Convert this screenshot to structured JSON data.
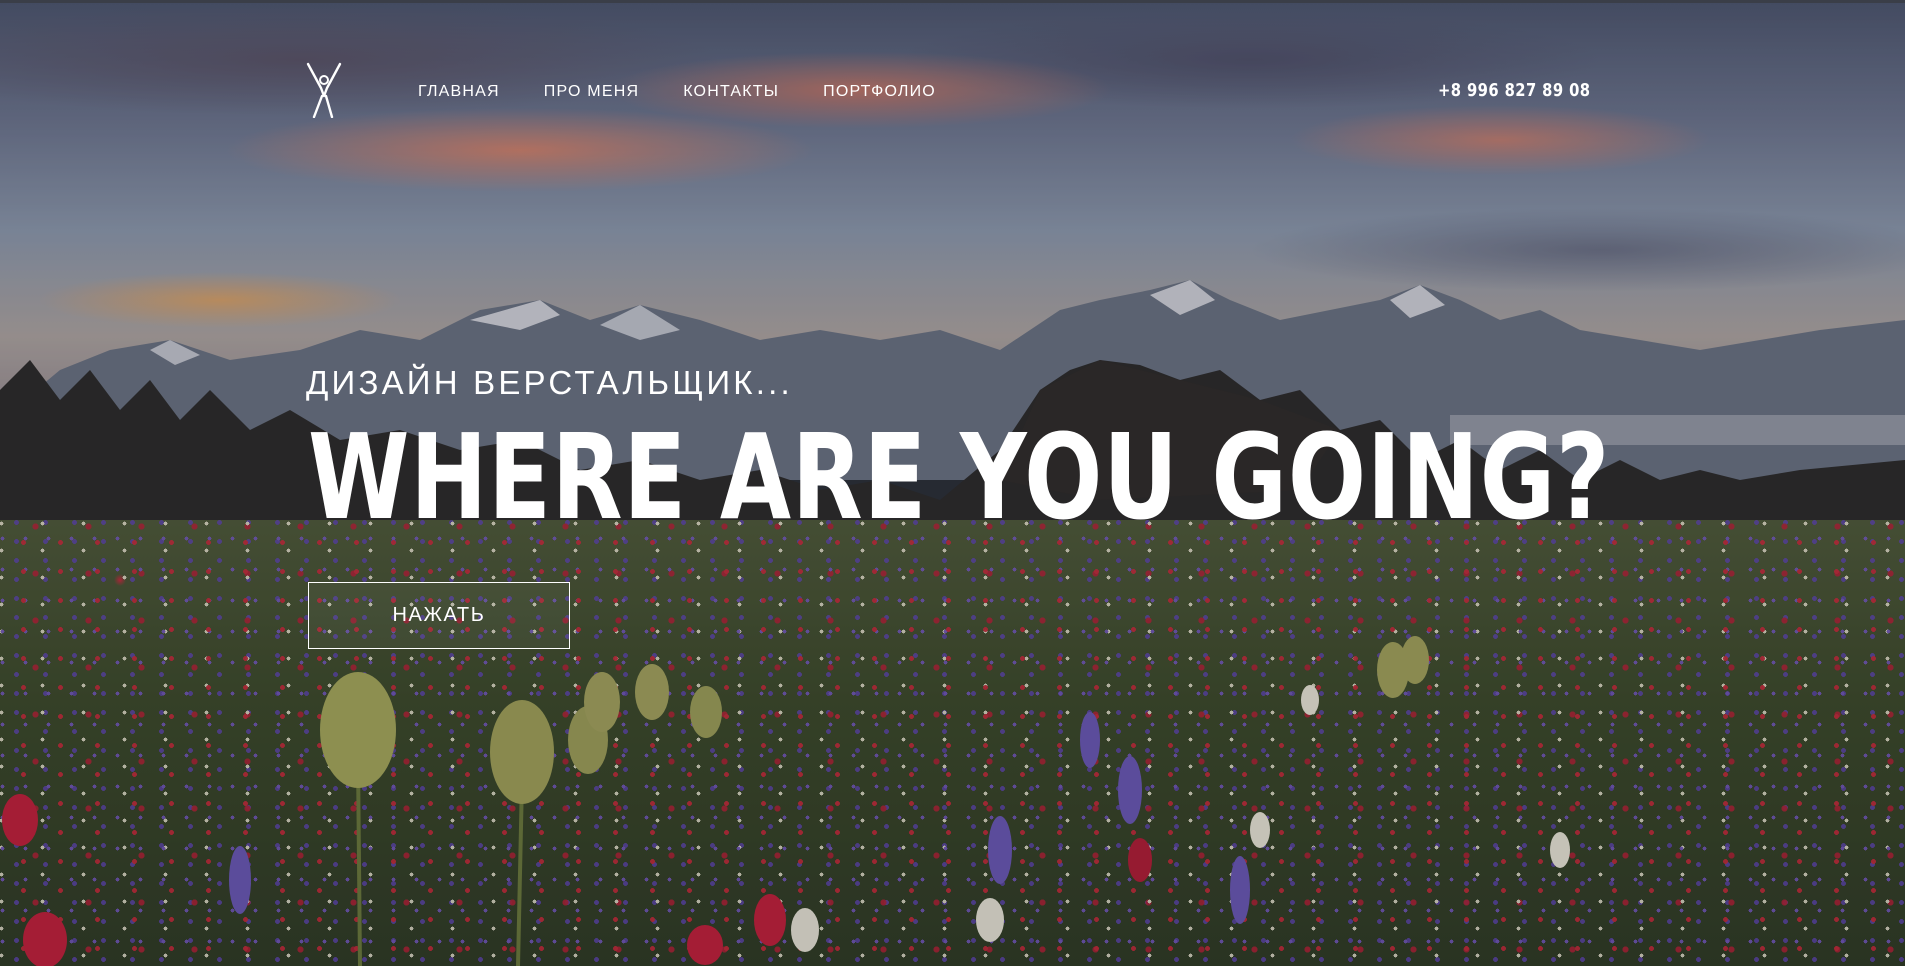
{
  "header": {
    "logo_icon": "person-arms-up-icon",
    "nav": [
      {
        "label": "ГЛАВНАЯ"
      },
      {
        "label": "ПРО МЕНЯ"
      },
      {
        "label": "КОНТАКТЫ"
      },
      {
        "label": "ПОРТФОЛИО"
      }
    ],
    "phone": "+8 996 827 89 08"
  },
  "hero": {
    "subtitle": "ДИЗАЙН ВЕРСТАЛЬЩИК...",
    "headline": "WHERE ARE YOU GOING?",
    "cta_label": "НАЖАТЬ"
  },
  "colors": {
    "text": "#ffffff",
    "button_border": "#ffffff"
  }
}
